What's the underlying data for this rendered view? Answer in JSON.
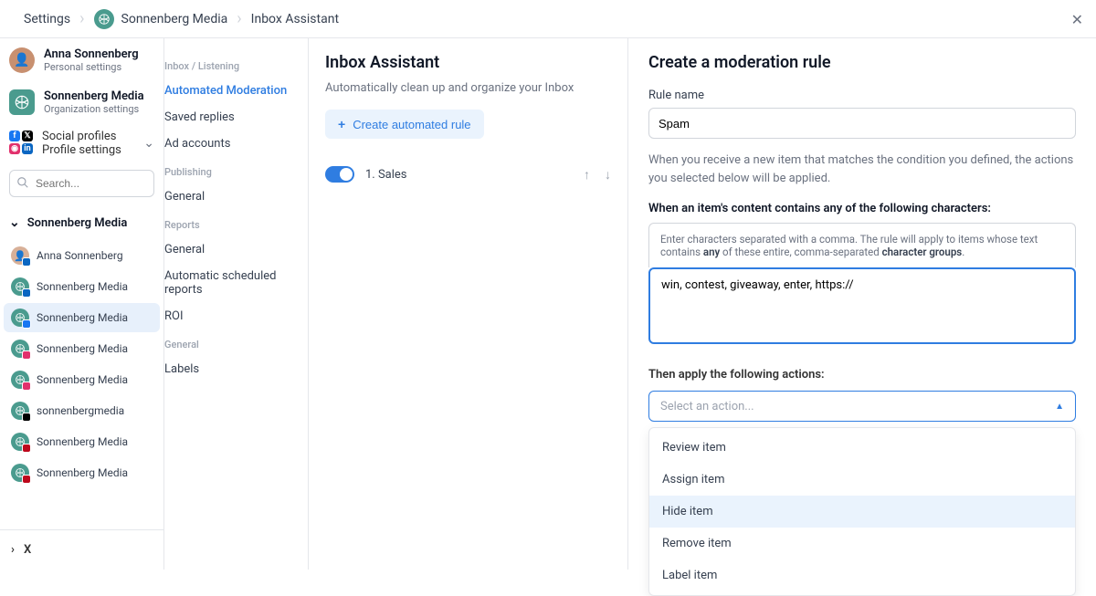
{
  "breadcrumb": {
    "root": "Settings",
    "org": "Sonnenberg Media",
    "page": "Inbox Assistant"
  },
  "topAccounts": {
    "personal": {
      "name": "Anna Sonnenberg",
      "sub": "Personal settings"
    },
    "org": {
      "name": "Sonnenberg Media",
      "sub": "Organization settings"
    },
    "social": {
      "name": "Social profiles",
      "sub": "Profile settings"
    }
  },
  "search": {
    "placeholder": "Search..."
  },
  "tree": {
    "header": "Sonnenberg Media"
  },
  "profiles": [
    {
      "name": "Anna Sonnenberg",
      "type": "person",
      "badge": "in"
    },
    {
      "name": "Sonnenberg Media",
      "type": "org",
      "badge": "in"
    },
    {
      "name": "Sonnenberg Media",
      "type": "org",
      "badge": "fb",
      "active": true
    },
    {
      "name": "Sonnenberg Media",
      "type": "org",
      "badge": "ig"
    },
    {
      "name": "Sonnenberg Media",
      "type": "org",
      "badge": "ig"
    },
    {
      "name": "sonnenbergmedia",
      "type": "org",
      "badge": "tt"
    },
    {
      "name": "Sonnenberg Media",
      "type": "org",
      "badge": "pin"
    },
    {
      "name": "Sonnenberg Media",
      "type": "org",
      "badge": "pin"
    }
  ],
  "bottomX": "X",
  "menu": {
    "inbox": {
      "heading": "Inbox / Listening",
      "items": [
        "Automated Moderation",
        "Saved replies",
        "Ad accounts"
      ]
    },
    "publishing": {
      "heading": "Publishing",
      "items": [
        "General"
      ]
    },
    "reports": {
      "heading": "Reports",
      "items": [
        "General",
        "Automatic scheduled reports",
        "ROI"
      ]
    },
    "general": {
      "heading": "General",
      "items": [
        "Labels"
      ]
    },
    "activeItem": "Automated Moderation"
  },
  "inboxAssistant": {
    "title": "Inbox Assistant",
    "subtitle": "Automatically clean up and organize your Inbox",
    "createButton": "Create automated rule",
    "rules": [
      {
        "label": "1. Sales",
        "enabled": true
      }
    ]
  },
  "moderation": {
    "title": "Create a moderation rule",
    "ruleNameLabel": "Rule name",
    "ruleNameValue": "Spam",
    "helper": "When you receive a new item that matches the condition you defined, the actions you selected below will be applied.",
    "conditionTitle": "When an item's content contains any of the following characters:",
    "hintPrefix": "Enter characters separated with a comma. The rule will apply to items whose text contains ",
    "hintBold1": "any",
    "hintMid": " of these entire, comma-separated ",
    "hintBold2": "character groups",
    "hintSuffix": ".",
    "charactersValue": "win, contest, giveaway, enter, https://",
    "actionTitle": "Then apply the following actions:",
    "dropdownPlaceholder": "Select an action...",
    "options": [
      "Review item",
      "Assign item",
      "Hide item",
      "Remove item",
      "Label item"
    ],
    "hovered": "Hide item"
  }
}
